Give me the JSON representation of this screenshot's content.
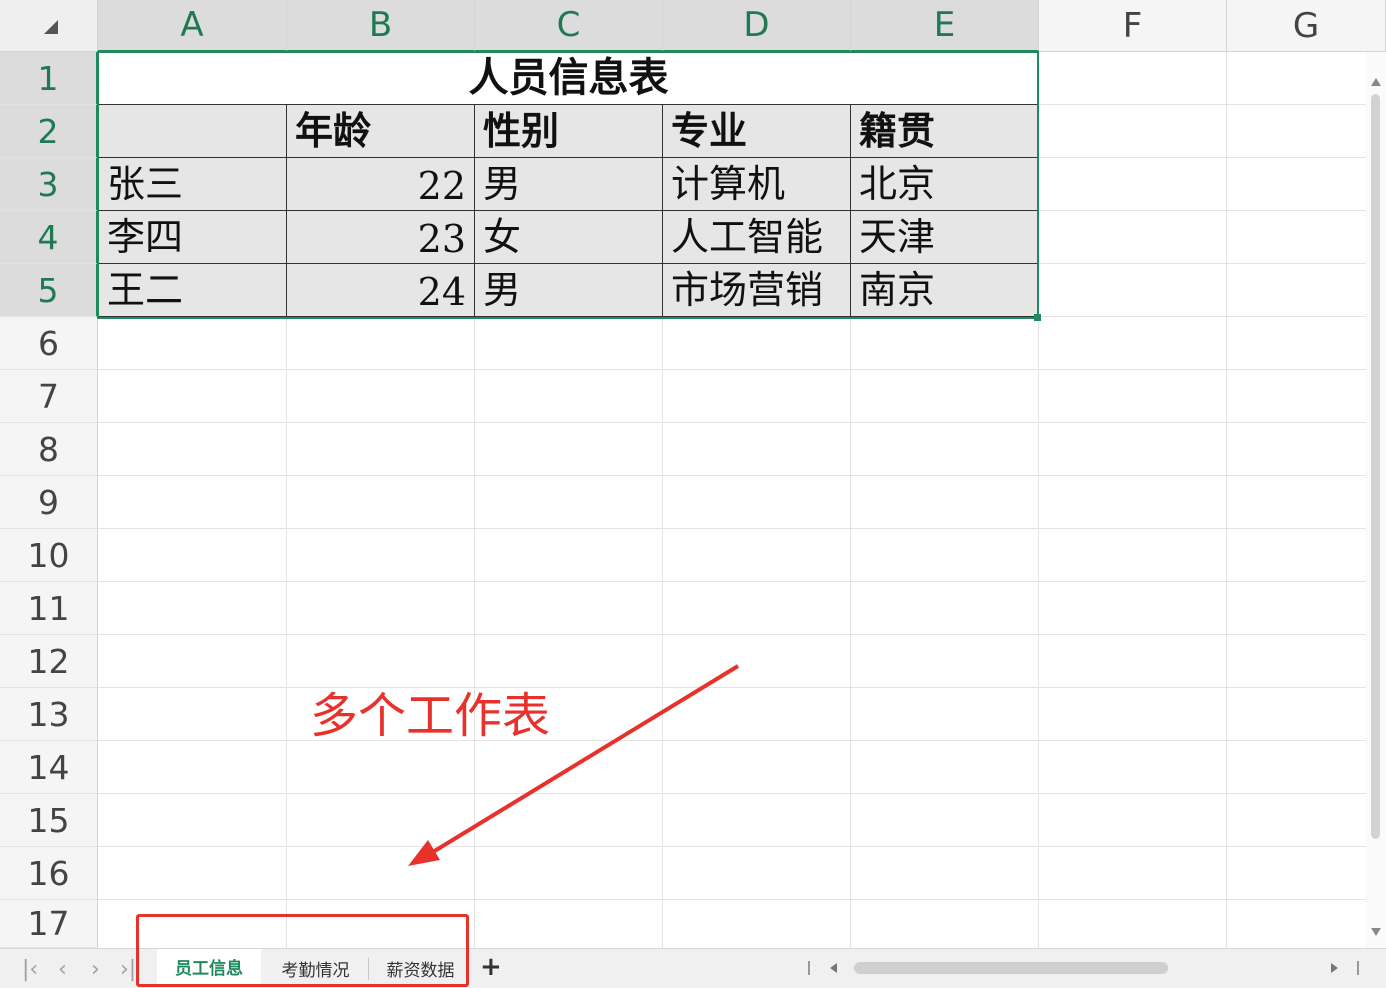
{
  "columns": [
    "A",
    "B",
    "C",
    "D",
    "E",
    "F",
    "G"
  ],
  "rows": [
    "1",
    "2",
    "3",
    "4",
    "5",
    "6",
    "7",
    "8",
    "9",
    "10",
    "11",
    "12",
    "13",
    "14",
    "15",
    "16",
    "17"
  ],
  "table": {
    "title": "人员信息表",
    "headers": [
      "",
      "年龄",
      "性别",
      "专业",
      "籍贯"
    ],
    "records": [
      [
        "张三",
        "22",
        "男",
        "计算机",
        "北京"
      ],
      [
        "李四",
        "23",
        "女",
        "人工智能",
        "天津"
      ],
      [
        "王二",
        "24",
        "男",
        "市场营销",
        "南京"
      ]
    ]
  },
  "sheet_tabs": [
    {
      "label": "员工信息",
      "active": true
    },
    {
      "label": "考勤情况",
      "active": false
    },
    {
      "label": "薪资数据",
      "active": false
    }
  ],
  "nav": {
    "first": "|‹",
    "prev": "‹",
    "next": "›",
    "last": "›|",
    "add": "+"
  },
  "annotation": {
    "text": "多个工作表",
    "color": "#e8312a"
  },
  "colors": {
    "accent": "#1f8a5e",
    "selected_header_bg": "#dcdcdc",
    "table_fill": "#e6e6e6"
  }
}
